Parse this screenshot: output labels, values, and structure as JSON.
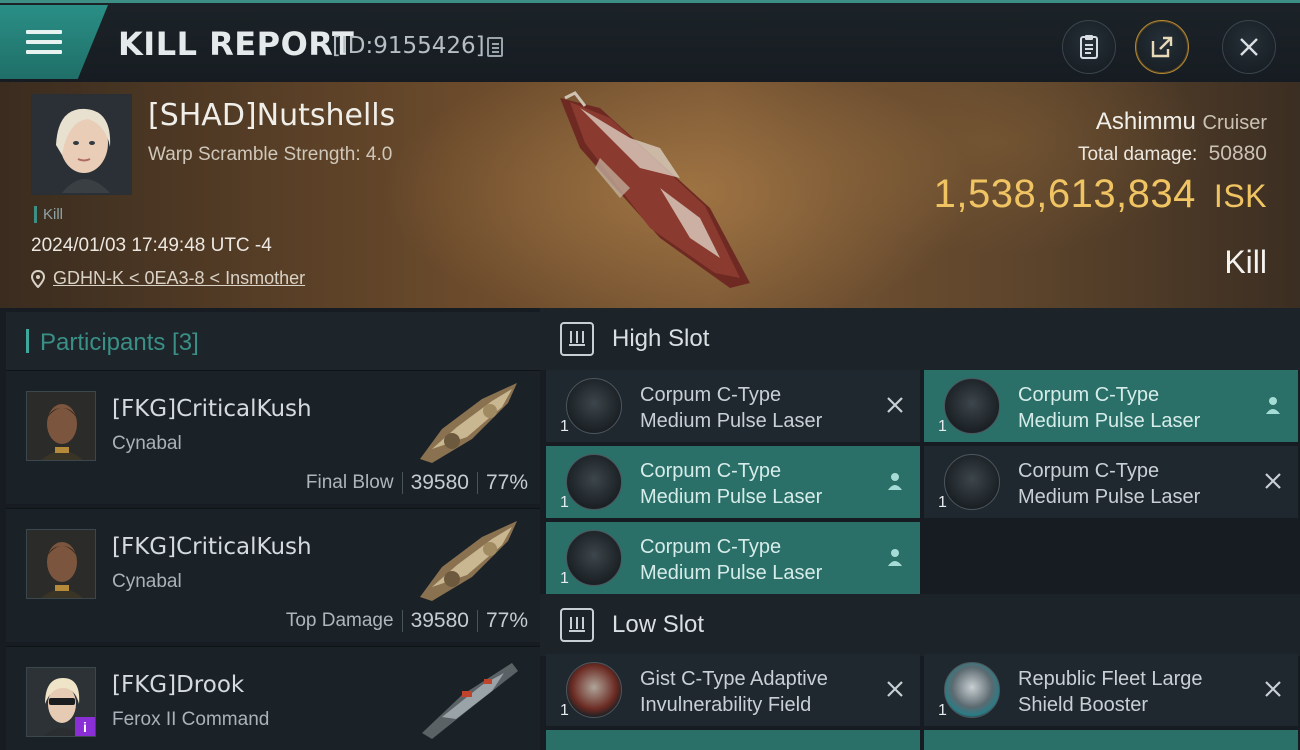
{
  "header": {
    "title": "KILL REPORT",
    "report_id": "[ID:9155426]"
  },
  "victim": {
    "name": "[SHAD]Nutshells",
    "scramble": "Warp Scramble Strength: 4.0",
    "kill_tag": "Kill",
    "timestamp": "2024/01/03 17:49:48 UTC -4",
    "location": "GDHN-K < 0EA3-8 < Insmother",
    "ship_name": "Ashimmu",
    "ship_class": "Cruiser",
    "total_damage_label": "Total damage:",
    "total_damage": "50880",
    "isk_value": "1,538,613,834",
    "isk_unit": "ISK",
    "result": "Kill"
  },
  "participants": {
    "label": "Participants [3]",
    "rows": [
      {
        "name": "[FKG]CriticalKush",
        "ship": "Cynabal",
        "role": "Final Blow",
        "damage": "39580",
        "percent": "77%"
      },
      {
        "name": "[FKG]CriticalKush",
        "ship": "Cynabal",
        "role": "Top Damage",
        "damage": "39580",
        "percent": "77%"
      },
      {
        "name": "[FKG]Drook",
        "ship": "Ferox II Command",
        "badge": "i"
      }
    ]
  },
  "fitting": {
    "high_slot": {
      "label": "High Slot",
      "modules": [
        {
          "qty": "1",
          "line1": "Corpum C-Type",
          "line2": "Medium Pulse Laser",
          "status": "destroyed"
        },
        {
          "qty": "1",
          "line1": "Corpum C-Type",
          "line2": "Medium Pulse Laser",
          "status": "dropped"
        },
        {
          "qty": "1",
          "line1": "Corpum C-Type",
          "line2": "Medium Pulse Laser",
          "status": "dropped"
        },
        {
          "qty": "1",
          "line1": "Corpum C-Type",
          "line2": "Medium Pulse Laser",
          "status": "destroyed"
        },
        {
          "qty": "1",
          "line1": "Corpum C-Type",
          "line2": "Medium Pulse Laser",
          "status": "dropped"
        }
      ]
    },
    "low_slot": {
      "label": "Low Slot",
      "modules": [
        {
          "qty": "1",
          "line1": "Gist C-Type Adaptive",
          "line2": "Invulnerability Field",
          "status": "destroyed"
        },
        {
          "qty": "1",
          "line1": "Republic Fleet Large",
          "line2": "Shield Booster",
          "status": "destroyed"
        }
      ]
    }
  },
  "colors": {
    "accent": "#3d8f86",
    "isk": "#f0c462",
    "active_module": "#2b6f69"
  }
}
